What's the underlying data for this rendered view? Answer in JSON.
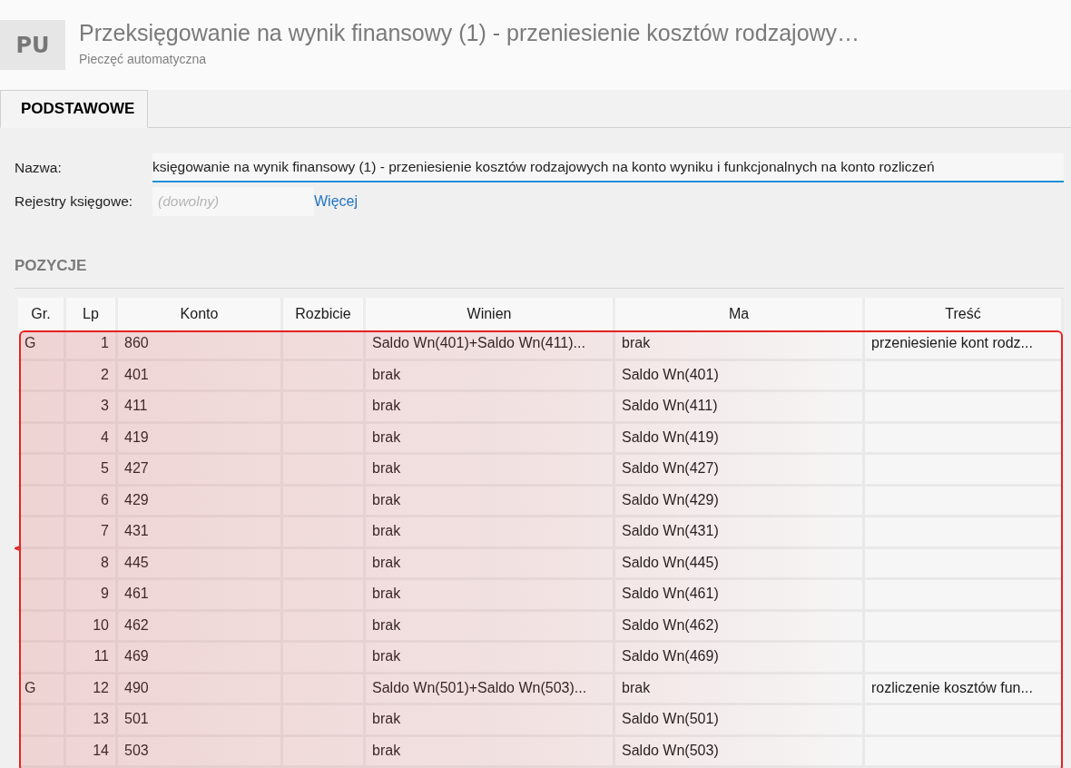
{
  "header": {
    "badge": "PU",
    "title": "Przeksięgowanie na wynik finansowy (1) - przeniesienie kosztów rodzajowy…",
    "subtitle": "Pieczęć automatyczna"
  },
  "tabs": [
    {
      "label": "PODSTAWOWE",
      "selected": true
    }
  ],
  "form": {
    "name_label": "Nazwa:",
    "name_value": "księgowanie na wynik finansowy (1) - przeniesienie kosztów rodzajowych na konto wyniku i funkcjonalnych na konto rozliczeń",
    "registers_label": "Rejestry księgowe:",
    "registers_placeholder": "(dowolny)",
    "more_link": "Więcej"
  },
  "section_title": "POZYCJE",
  "table": {
    "highlighted": true,
    "columns": [
      "Gr.",
      "Lp",
      "Konto",
      "Rozbicie",
      "Winien",
      "Ma",
      "Treść"
    ],
    "rows": [
      {
        "gr": "G",
        "lp": "1",
        "konto": "860",
        "winien": "Saldo Wn(401)+Saldo Wn(411)...",
        "ma": "brak",
        "tresc": "przeniesienie kont rodz..."
      },
      {
        "lp": "2",
        "konto": "401",
        "winien": "brak",
        "ma": "Saldo Wn(401)"
      },
      {
        "lp": "3",
        "konto": "411",
        "winien": "brak",
        "ma": "Saldo Wn(411)"
      },
      {
        "lp": "4",
        "konto": "419",
        "winien": "brak",
        "ma": "Saldo Wn(419)"
      },
      {
        "lp": "5",
        "konto": "427",
        "winien": "brak",
        "ma": "Saldo Wn(427)"
      },
      {
        "lp": "6",
        "konto": "429",
        "winien": "brak",
        "ma": "Saldo Wn(429)"
      },
      {
        "lp": "7",
        "konto": "431",
        "winien": "brak",
        "ma": "Saldo Wn(431)"
      },
      {
        "lp": "8",
        "konto": "445",
        "winien": "brak",
        "ma": "Saldo Wn(445)"
      },
      {
        "lp": "9",
        "konto": "461",
        "winien": "brak",
        "ma": "Saldo Wn(461)"
      },
      {
        "lp": "10",
        "konto": "462",
        "winien": "brak",
        "ma": "Saldo Wn(462)"
      },
      {
        "lp": "11",
        "konto": "469",
        "winien": "brak",
        "ma": "Saldo Wn(469)"
      },
      {
        "gr": "G",
        "lp": "12",
        "konto": "490",
        "winien": "Saldo Wn(501)+Saldo Wn(503)...",
        "ma": "brak",
        "tresc": "rozliczenie kosztów fun..."
      },
      {
        "lp": "13",
        "konto": "501",
        "winien": "brak",
        "ma": "Saldo Wn(501)"
      },
      {
        "lp": "14",
        "konto": "503",
        "winien": "brak",
        "ma": "Saldo Wn(503)"
      }
    ]
  }
}
